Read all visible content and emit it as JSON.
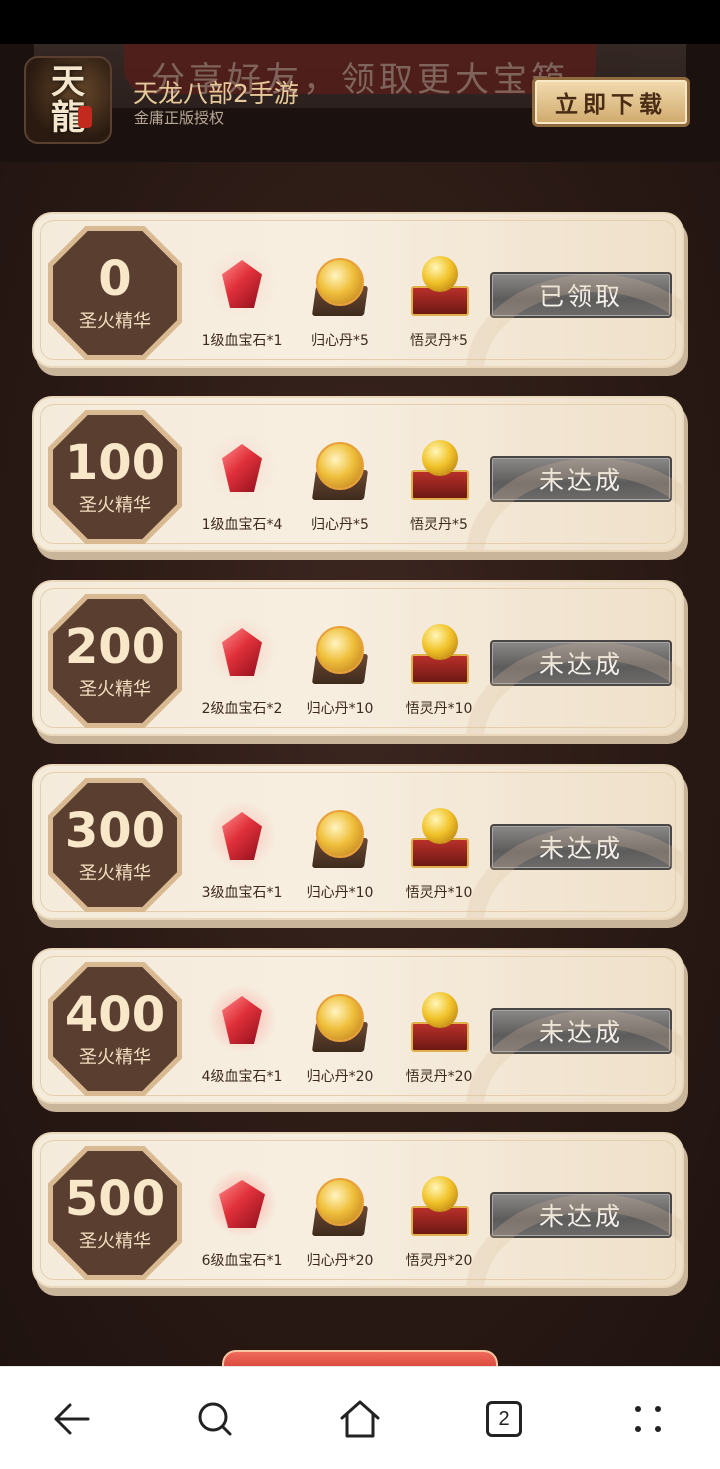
{
  "banner": {
    "ghost_text": "分享好友，领取更大宝箱",
    "app_logo_text": "天龍",
    "app_title": "天龙八部2手游",
    "app_subtitle": "金庸正版授权",
    "download_label": "立即下载"
  },
  "rewards": [
    {
      "threshold": "0",
      "unit": "圣火精华",
      "gem": "1级血宝石*1",
      "pill": "归心丹*5",
      "chest": "悟灵丹*5",
      "status": "已领取"
    },
    {
      "threshold": "100",
      "unit": "圣火精华",
      "gem": "1级血宝石*4",
      "pill": "归心丹*5",
      "chest": "悟灵丹*5",
      "status": "未达成"
    },
    {
      "threshold": "200",
      "unit": "圣火精华",
      "gem": "2级血宝石*2",
      "pill": "归心丹*10",
      "chest": "悟灵丹*10",
      "status": "未达成"
    },
    {
      "threshold": "300",
      "unit": "圣火精华",
      "gem": "3级血宝石*1",
      "pill": "归心丹*10",
      "chest": "悟灵丹*10",
      "status": "未达成"
    },
    {
      "threshold": "400",
      "unit": "圣火精华",
      "gem": "4级血宝石*1",
      "pill": "归心丹*20",
      "chest": "悟灵丹*20",
      "status": "未达成"
    },
    {
      "threshold": "500",
      "unit": "圣火精华",
      "gem": "6级血宝石*1",
      "pill": "归心丹*20",
      "chest": "悟灵丹*20",
      "status": "未达成"
    }
  ],
  "nav": {
    "tab_count": "2",
    "icons": [
      "back-icon",
      "search-icon",
      "home-icon",
      "tabs-icon",
      "menu-icon"
    ]
  },
  "colors": {
    "card_bg": "#f5ebdb",
    "badge_bg": "#5a3f30",
    "status_btn": "#6d6a6a",
    "download_btn": "#e6c48a"
  }
}
